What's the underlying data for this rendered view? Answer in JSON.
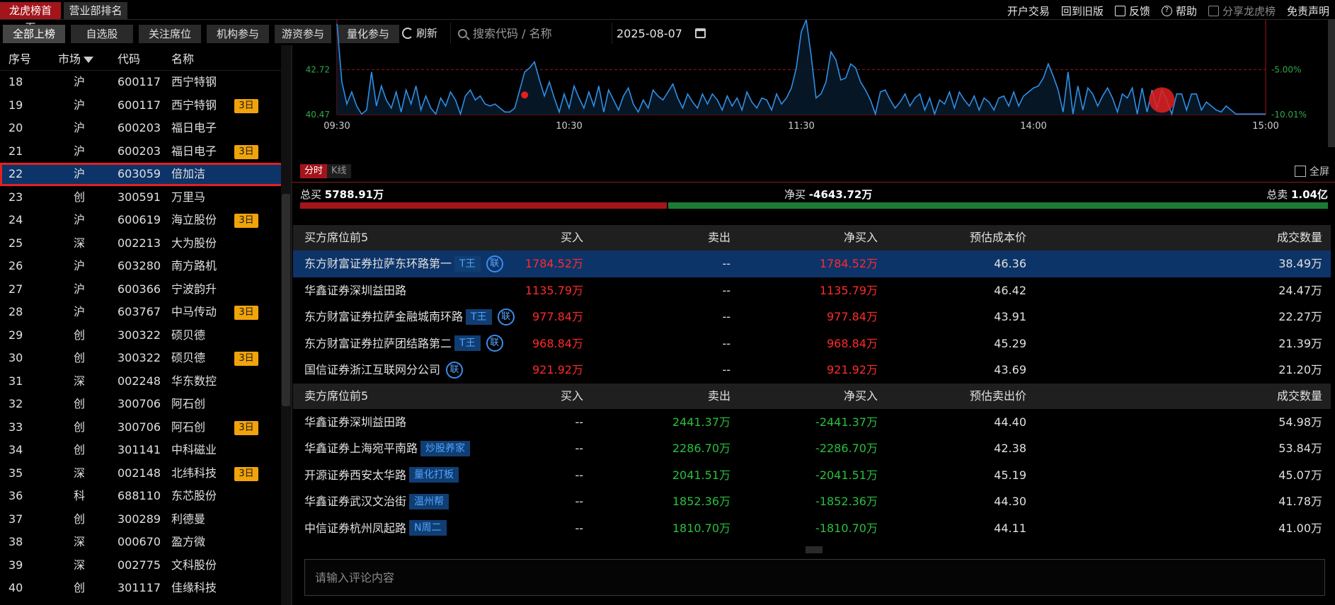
{
  "top_tabs": {
    "home": "龙虎榜首页",
    "branch_rank": "营业部排名"
  },
  "top_links": {
    "open_account": "开户交易",
    "old_version": "回到旧版",
    "feedback": "反馈",
    "help": "帮助",
    "share": "分享龙虎榜",
    "disclaimer": "免责声明"
  },
  "filters": [
    "全部上榜",
    "自选股",
    "关注席位",
    "机构参与",
    "游资参与",
    "量化参与"
  ],
  "refresh_label": "刷新",
  "search_placeholder": "搜索代码 / 名称",
  "date": "2025-08-07",
  "list_header": {
    "seq": "序号",
    "market": "市场",
    "code": "代码",
    "name": "名称"
  },
  "list_rows": [
    {
      "seq": "18",
      "market": "沪",
      "code": "600117",
      "name": "西宁特钢",
      "badge": ""
    },
    {
      "seq": "19",
      "market": "沪",
      "code": "600117",
      "name": "西宁特钢",
      "badge": "3日"
    },
    {
      "seq": "20",
      "market": "沪",
      "code": "600203",
      "name": "福日电子",
      "badge": ""
    },
    {
      "seq": "21",
      "market": "沪",
      "code": "600203",
      "name": "福日电子",
      "badge": "3日"
    },
    {
      "seq": "22",
      "market": "沪",
      "code": "603059",
      "name": "倍加洁",
      "badge": "",
      "selected": true
    },
    {
      "seq": "23",
      "market": "创",
      "code": "300591",
      "name": "万里马",
      "badge": ""
    },
    {
      "seq": "24",
      "market": "沪",
      "code": "600619",
      "name": "海立股份",
      "badge": "3日"
    },
    {
      "seq": "25",
      "market": "深",
      "code": "002213",
      "name": "大为股份",
      "badge": ""
    },
    {
      "seq": "26",
      "market": "沪",
      "code": "603280",
      "name": "南方路机",
      "badge": ""
    },
    {
      "seq": "27",
      "market": "沪",
      "code": "600366",
      "name": "宁波韵升",
      "badge": ""
    },
    {
      "seq": "28",
      "market": "沪",
      "code": "603767",
      "name": "中马传动",
      "badge": "3日"
    },
    {
      "seq": "29",
      "market": "创",
      "code": "300322",
      "name": "硕贝德",
      "badge": ""
    },
    {
      "seq": "30",
      "market": "创",
      "code": "300322",
      "name": "硕贝德",
      "badge": "3日"
    },
    {
      "seq": "31",
      "market": "深",
      "code": "002248",
      "name": "华东数控",
      "badge": ""
    },
    {
      "seq": "32",
      "market": "创",
      "code": "300706",
      "name": "阿石创",
      "badge": ""
    },
    {
      "seq": "33",
      "market": "创",
      "code": "300706",
      "name": "阿石创",
      "badge": "3日"
    },
    {
      "seq": "34",
      "market": "创",
      "code": "301141",
      "name": "中科磁业",
      "badge": ""
    },
    {
      "seq": "35",
      "market": "深",
      "code": "002148",
      "name": "北纬科技",
      "badge": "3日"
    },
    {
      "seq": "36",
      "market": "科",
      "code": "688110",
      "name": "东芯股份",
      "badge": ""
    },
    {
      "seq": "37",
      "market": "创",
      "code": "300289",
      "name": "利德曼",
      "badge": ""
    },
    {
      "seq": "38",
      "market": "深",
      "code": "000670",
      "name": "盈方微",
      "badge": ""
    },
    {
      "seq": "39",
      "market": "深",
      "code": "002775",
      "name": "文科股份",
      "badge": ""
    },
    {
      "seq": "40",
      "market": "创",
      "code": "301117",
      "name": "佳缘科技",
      "badge": ""
    }
  ],
  "chart_data": {
    "type": "line",
    "y_left_ticks": [
      "42.72",
      "40.47"
    ],
    "y_right_ticks": [
      "-5.00%",
      "-10.01%"
    ],
    "x_ticks": [
      "09:30",
      "10:30",
      "11:30",
      "14:00",
      "15:00"
    ],
    "ylim": [
      40.47,
      45.2
    ],
    "reference_price": 42.72,
    "colors": {
      "line": "#2f8fe6",
      "ref_line": "#a3151b",
      "marker": "#e32020"
    },
    "prices": [
      45.0,
      42.1,
      41.0,
      41.6,
      40.9,
      40.5,
      40.7,
      42.6,
      40.9,
      41.9,
      41.2,
      40.8,
      41.6,
      40.6,
      41.7,
      41.0,
      41.9,
      40.7,
      41.4,
      40.8,
      40.5,
      41.3,
      40.9,
      41.6,
      41.2,
      40.5,
      41.4,
      41.7,
      41.2,
      41.4,
      41.0,
      40.9,
      41.0,
      40.8,
      40.6,
      40.6,
      40.8,
      41.7,
      42.6,
      42.8,
      43.1,
      42.2,
      41.4,
      42.1,
      41.3,
      40.6,
      41.5,
      40.8,
      41.9,
      41.3,
      40.8,
      41.6,
      40.9,
      41.9,
      40.6,
      41.7,
      41.2,
      40.7,
      41.4,
      41.8,
      41.0,
      40.6,
      41.2,
      40.8,
      41.7,
      41.4,
      41.2,
      41.6,
      42.0,
      41.3,
      40.8,
      41.5,
      41.1,
      40.8,
      41.5,
      41.0,
      41.5,
      41.2,
      40.7,
      41.4,
      40.9,
      41.3,
      40.7,
      41.6,
      41.1,
      40.8,
      41.3,
      41.2,
      40.7,
      41.5,
      41.0,
      41.3,
      41.8,
      42.8,
      44.6,
      45.2,
      43.4,
      41.3,
      41.5,
      42.1,
      43.6,
      43.2,
      42.2,
      42.3,
      43.0,
      42.8,
      42.1,
      41.7,
      41.2,
      40.5,
      41.6,
      41.7,
      41.2,
      40.8,
      41.1,
      41.5,
      40.9,
      41.3,
      41.5,
      40.7,
      41.3,
      40.5,
      41.2,
      41.0,
      41.6,
      40.8,
      41.6,
      41.2,
      40.9,
      41.4,
      40.7,
      41.3,
      41.1,
      40.7,
      41.3,
      41.4,
      40.9,
      41.6,
      40.9,
      41.4,
      41.6,
      41.8,
      41.9,
      42.3,
      43.0,
      42.4,
      41.7,
      40.6,
      42.6,
      40.5,
      41.9,
      40.7,
      41.8,
      41.5,
      40.9,
      41.4,
      41.8,
      41.3,
      40.6,
      41.5,
      41.3,
      41.8,
      40.5,
      41.8,
      40.6,
      41.7,
      40.8,
      41.7,
      41.2,
      40.5,
      41.5,
      41.5,
      40.7,
      41.5,
      41.5,
      40.7,
      41.1,
      40.9,
      40.7,
      40.6,
      40.9,
      40.7,
      40.5,
      40.5,
      40.5,
      40.5,
      40.5,
      40.5,
      40.5
    ],
    "markers": [
      {
        "index": 38,
        "price": 41.45,
        "size": "small"
      },
      {
        "index": 167,
        "price": 41.2,
        "size": "large"
      }
    ]
  },
  "chart_tabs": {
    "minute": "分时",
    "kline": "K线"
  },
  "fullscreen_label": "全屏",
  "summary": {
    "total_buy_label": "总买",
    "total_buy": "5788.91万",
    "net_buy_label": "净买",
    "net_buy": "-4643.72万",
    "total_sell_label": "总卖",
    "total_sell": "1.04亿",
    "buy_ratio": 0.357
  },
  "buy_header": {
    "name": "买方席位前5",
    "buy": "买入",
    "sell": "卖出",
    "net": "净买入",
    "cost": "预估成本价",
    "volume": "成交数量"
  },
  "buy_rows": [
    {
      "name": "东方财富证券拉萨东环路第一",
      "tag": "T王",
      "lian": true,
      "buy": "1784.52万",
      "sell": "--",
      "net": "1784.52万",
      "cost": "46.36",
      "volume": "38.49万",
      "highlight": true
    },
    {
      "name": "华鑫证券深圳益田路",
      "tag": "",
      "lian": false,
      "buy": "1135.79万",
      "sell": "--",
      "net": "1135.79万",
      "cost": "46.42",
      "volume": "24.47万"
    },
    {
      "name": "东方财富证券拉萨金融城南环路",
      "tag": "T王",
      "lian": true,
      "buy": "977.84万",
      "sell": "--",
      "net": "977.84万",
      "cost": "43.91",
      "volume": "22.27万"
    },
    {
      "name": "东方财富证券拉萨团结路第二",
      "tag": "T王",
      "lian": true,
      "buy": "968.84万",
      "sell": "--",
      "net": "968.84万",
      "cost": "45.29",
      "volume": "21.39万"
    },
    {
      "name": "国信证券浙江互联网分公司",
      "tag": "",
      "lian": true,
      "buy": "921.92万",
      "sell": "--",
      "net": "921.92万",
      "cost": "43.69",
      "volume": "21.20万"
    }
  ],
  "sell_header": {
    "name": "卖方席位前5",
    "buy": "买入",
    "sell": "卖出",
    "net": "净买入",
    "cost": "预估卖出价",
    "volume": "成交数量"
  },
  "sell_rows": [
    {
      "name": "华鑫证券深圳益田路",
      "tag": "",
      "buy": "--",
      "sell": "2441.37万",
      "net": "-2441.37万",
      "cost": "44.40",
      "volume": "54.98万"
    },
    {
      "name": "华鑫证券上海宛平南路",
      "tag": "炒股养家",
      "buy": "--",
      "sell": "2286.70万",
      "net": "-2286.70万",
      "cost": "42.38",
      "volume": "53.84万"
    },
    {
      "name": "开源证券西安太华路",
      "tag": "量化打板",
      "buy": "--",
      "sell": "2041.51万",
      "net": "-2041.51万",
      "cost": "45.19",
      "volume": "45.07万"
    },
    {
      "name": "华鑫证券武汉文治街",
      "tag": "温州帮",
      "buy": "--",
      "sell": "1852.36万",
      "net": "-1852.36万",
      "cost": "44.30",
      "volume": "41.78万"
    },
    {
      "name": "中信证券杭州凤起路",
      "tag": "N周二",
      "buy": "--",
      "sell": "1810.70万",
      "net": "-1810.70万",
      "cost": "44.11",
      "volume": "41.00万"
    }
  ],
  "lian_label": "联",
  "comment_placeholder": "请输入评论内容"
}
